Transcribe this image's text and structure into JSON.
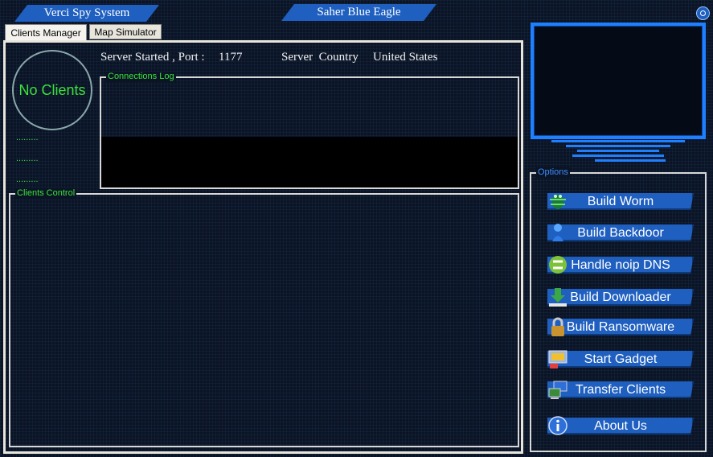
{
  "header": {
    "left_title": "Verci Spy System",
    "center_title": "Saher Blue Eagle"
  },
  "tabs": [
    {
      "label": "Clients Manager",
      "selected": true
    },
    {
      "label": "Map Simulator",
      "selected": false
    }
  ],
  "clients_panel": {
    "status_circle_text": "No Clients",
    "placeholder_dots": [
      ".........",
      ".........",
      "........."
    ],
    "server_started_label": "Server Started , Port :",
    "port": "1177",
    "server_country_label": "Server  Country",
    "country": "United States",
    "connections_log_label": "Connections Log",
    "clients_control_label": "Clients Control"
  },
  "options": {
    "label": "Options",
    "buttons": [
      {
        "label": "Build Worm",
        "icon": "worm-icon"
      },
      {
        "label": "Build Backdoor",
        "icon": "backdoor-icon"
      },
      {
        "label": "Handle noip DNS",
        "icon": "dns-icon"
      },
      {
        "label": "Build Downloader",
        "icon": "download-icon"
      },
      {
        "label": "Build Ransomware",
        "icon": "padlock-icon"
      },
      {
        "label": "Start Gadget",
        "icon": "gadget-icon"
      },
      {
        "label": "Transfer Clients",
        "icon": "transfer-icon"
      },
      {
        "label": "About Us",
        "icon": "info-icon"
      }
    ]
  },
  "colors": {
    "accent_blue": "#1e5fc0",
    "status_green": "#3ce13c",
    "background": "#0b1424"
  }
}
